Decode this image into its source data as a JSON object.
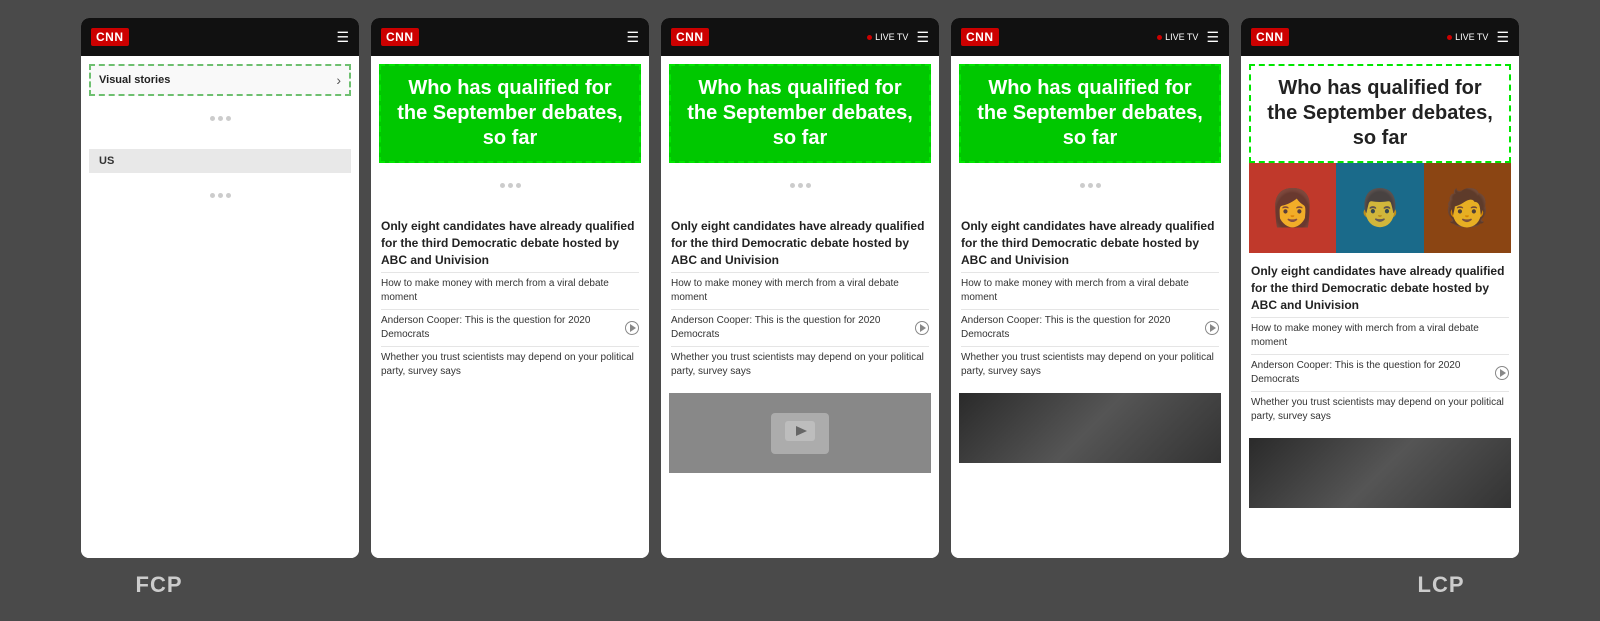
{
  "phones": [
    {
      "id": "phone-1",
      "header": {
        "logo": "CNN",
        "show_live_tv": false,
        "menu_icon": "☰"
      },
      "content_type": "fcp-initial",
      "visual_stories_label": "Visual stories",
      "us_section": "US",
      "loading_areas": 3
    },
    {
      "id": "phone-2",
      "header": {
        "logo": "CNN",
        "show_live_tv": false,
        "menu_icon": "☰"
      },
      "content_type": "article-no-image",
      "headline": "Who has qualified for the September debates, so far",
      "main_text": "Only eight candidates have already qualified for the third Democratic debate hosted by ABC and Univision",
      "sub_items": [
        {
          "text": "How to make money with merch from a viral debate moment",
          "has_play": false
        },
        {
          "text": "Anderson Cooper: This is the question for 2020 Democrats",
          "has_play": true
        },
        {
          "text": "Whether you trust scientists may depend on your political party, survey says",
          "has_play": false
        }
      ]
    },
    {
      "id": "phone-3",
      "header": {
        "logo": "CNN",
        "show_live_tv": true,
        "live_label": "LIVE TV",
        "menu_icon": "☰"
      },
      "content_type": "article-with-video",
      "headline": "Who has qualified for the September debates, so far",
      "main_text": "Only eight candidates have already qualified for the third Democratic debate hosted by ABC and Univision",
      "sub_items": [
        {
          "text": "How to make money with merch from a viral debate moment",
          "has_play": false
        },
        {
          "text": "Anderson Cooper: This is the question for 2020 Democrats",
          "has_play": true
        },
        {
          "text": "Whether you trust scientists may depend on your political party, survey says",
          "has_play": false
        }
      ]
    },
    {
      "id": "phone-4",
      "header": {
        "logo": "CNN",
        "show_live_tv": true,
        "live_label": "LIVE TV",
        "menu_icon": "☰"
      },
      "content_type": "article-with-image",
      "headline": "Who has qualified for the September debates, so far",
      "main_text": "Only eight candidates have already qualified for the third Democratic debate hosted by ABC and Univision",
      "sub_items": [
        {
          "text": "How to make money with merch from a viral debate moment",
          "has_play": false
        },
        {
          "text": "Anderson Cooper: This is the question for 2020 Democrats",
          "has_play": true
        },
        {
          "text": "Whether you trust scientists may depend on your political party, survey says",
          "has_play": false
        }
      ]
    },
    {
      "id": "phone-5",
      "header": {
        "logo": "CNN",
        "show_live_tv": true,
        "live_label": "LIVE TV",
        "menu_icon": "☰"
      },
      "content_type": "article-lcp",
      "headline": "Who has qualified for the September debates, so far",
      "main_text": "Only eight candidates have already qualified for the third Democratic debate hosted by ABC and Univision",
      "sub_items": [
        {
          "text": "How to make money with merch from a viral debate moment",
          "has_play": false
        },
        {
          "text": "Anderson Cooper: This is the question for 2020 Democrats",
          "has_play": true
        },
        {
          "text": "Whether you trust scientists may depend on your political party, survey says",
          "has_play": false
        }
      ]
    }
  ],
  "labels": {
    "fcp": "FCP",
    "lcp": "LCP"
  }
}
